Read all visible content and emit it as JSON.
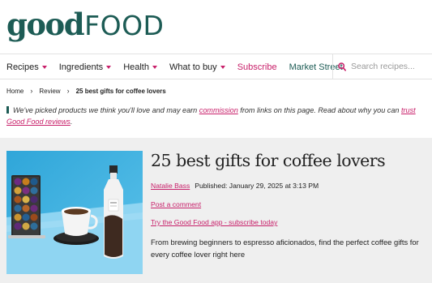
{
  "brand": {
    "logo_left": "good",
    "logo_right": "FOOD",
    "primary_color": "#1d5c55",
    "accent_color": "#c8206a"
  },
  "nav": {
    "items": [
      {
        "label": "Recipes",
        "has_dropdown": true
      },
      {
        "label": "Ingredients",
        "has_dropdown": true
      },
      {
        "label": "Health",
        "has_dropdown": true
      },
      {
        "label": "What to buy",
        "has_dropdown": true
      }
    ],
    "subscribe_label": "Subscribe",
    "market_label": "Market Street",
    "search_icon": "search-icon",
    "search_placeholder": "Search recipes..."
  },
  "breadcrumb": {
    "home": "Home",
    "section": "Review",
    "current": "25 best gifts for coffee lovers"
  },
  "disclosure": {
    "part1": "We've picked products we think you'll love and may earn ",
    "link1": "commission",
    "part2": " from links on this page. Read about why you can ",
    "link2": "trust Good Food reviews",
    "part3": "."
  },
  "article": {
    "title": "25 best gifts for coffee lovers",
    "author": "Natalie Bass",
    "published": "Published: January 29, 2025 at 3:13 PM",
    "post_comment": "Post a comment",
    "app_link": "Try the Good Food app - subscribe today",
    "summary": "From brewing beginners to espresso aficionados, find the perfect coffee gifts for every coffee lover right here"
  }
}
